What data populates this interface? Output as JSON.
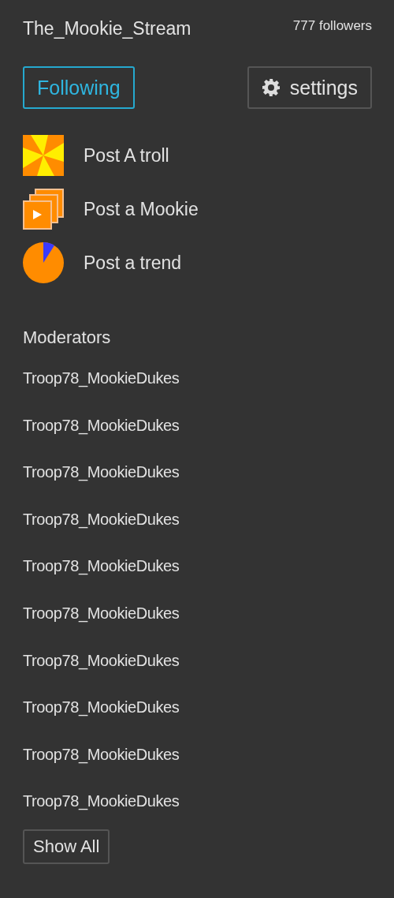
{
  "header": {
    "name": "The_Mookie_Stream",
    "followers": "777 followers"
  },
  "follow_button": {
    "label": "Following",
    "active": true
  },
  "settings_button": {
    "label": "settings"
  },
  "actions": [
    {
      "kind": "pinwheel",
      "label": "Post A troll"
    },
    {
      "kind": "stack",
      "label": "Post a Mookie"
    },
    {
      "kind": "pie",
      "label": "Post a trend"
    }
  ],
  "moderators": {
    "title": "Moderators",
    "items": [
      "Troop78_MookieDukes",
      "Troop78_MookieDukes",
      "Troop78_MookieDukes",
      "Troop78_MookieDukes",
      "Troop78_MookieDukes",
      "Troop78_MookieDukes",
      "Troop78_MookieDukes",
      "Troop78_MookieDukes",
      "Troop78_MookieDukes",
      "Troop78_MookieDukes"
    ],
    "show_all": "Show All"
  }
}
